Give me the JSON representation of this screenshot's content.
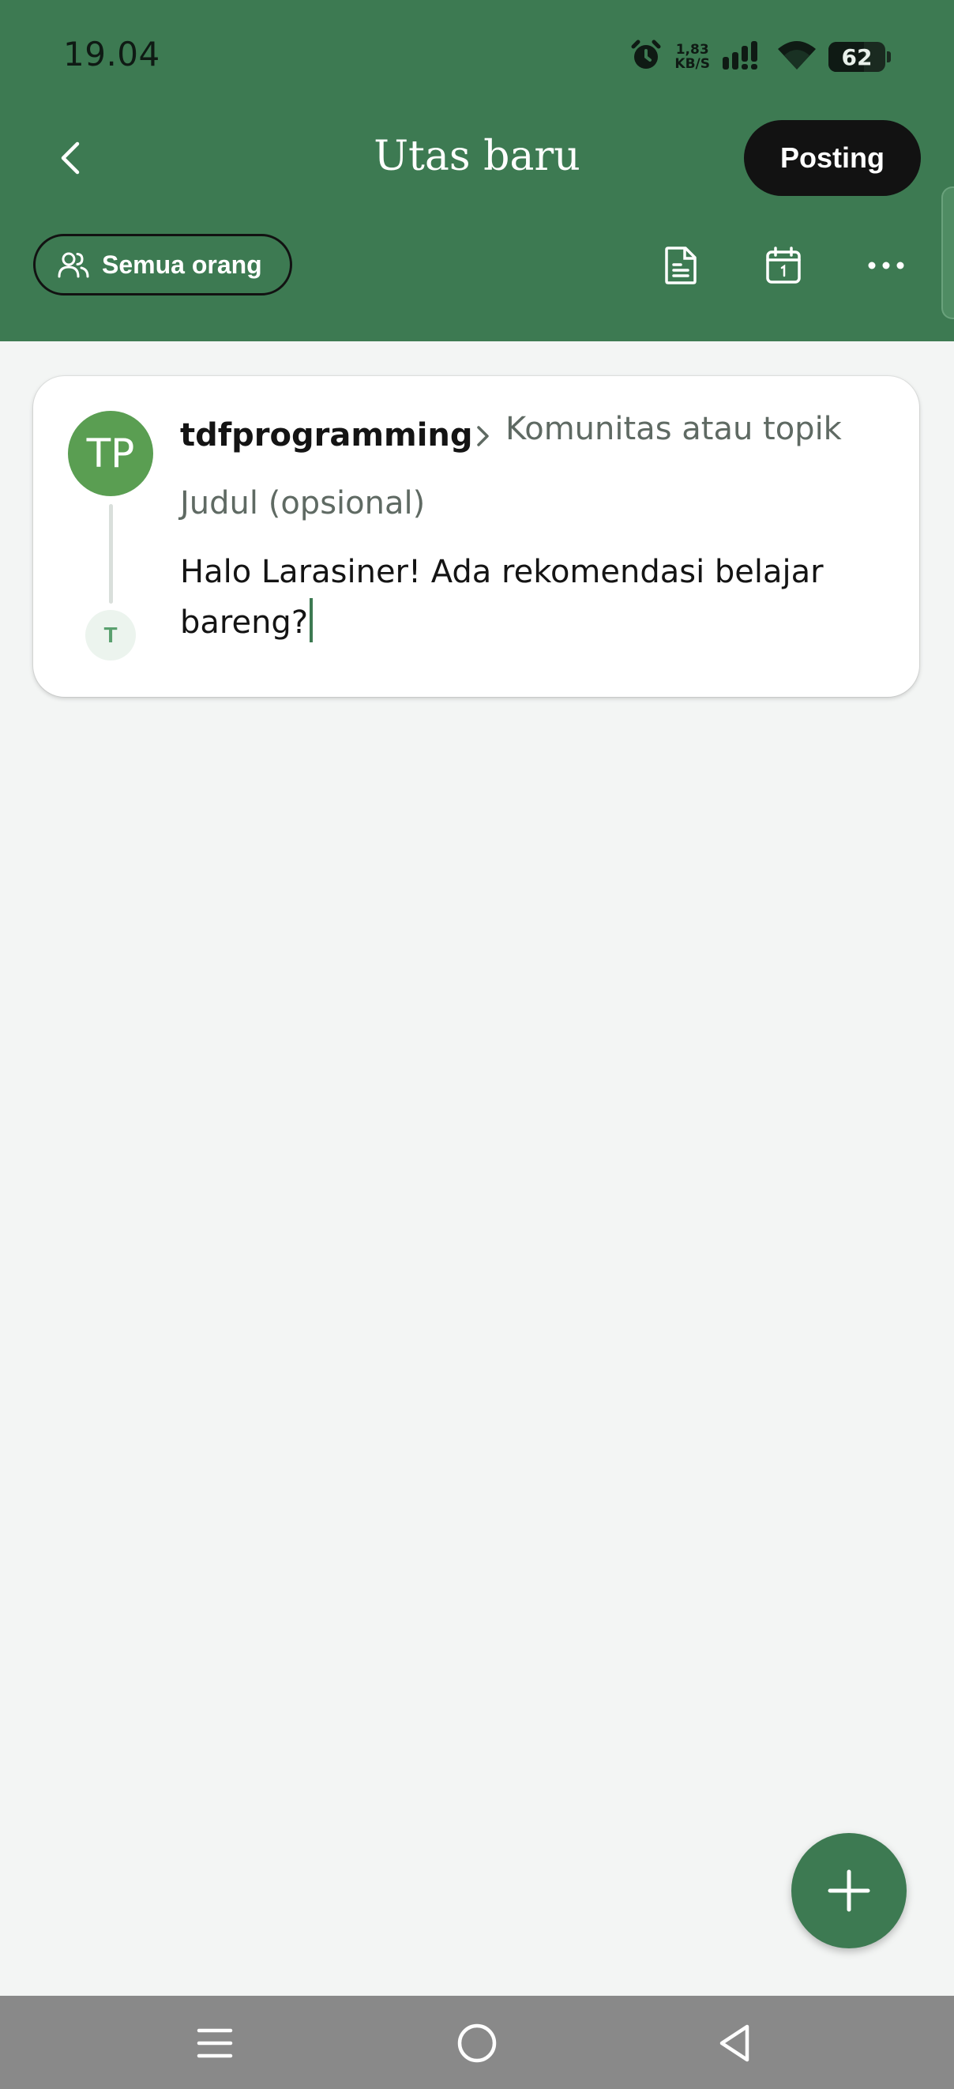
{
  "status_bar": {
    "time": "19.04",
    "net_speed_value": "1,83",
    "net_speed_unit": "KB/S",
    "battery_level": "62",
    "battery_fraction": 0.62,
    "icons": [
      "alarm-icon",
      "signal-icon",
      "wifi-icon",
      "battery-icon"
    ]
  },
  "appbar": {
    "back_icon": "chevron-left-icon",
    "title": "Utas baru",
    "post_label": "Posting"
  },
  "toolbar": {
    "audience_icon": "people-icon",
    "audience_label": "Semua orang",
    "actions": [
      "document-icon",
      "calendar-icon",
      "more-icon"
    ]
  },
  "composer": {
    "avatar_initials": "TP",
    "reply_avatar_initial": "T",
    "username": "tdfprogramming",
    "community_placeholder": "Komunitas atau topik",
    "title_placeholder": "Judul (opsional)",
    "body_text": "Halo Larasiner! Ada rekomendasi belajar bareng?"
  },
  "fab": {
    "icon": "plus-icon"
  },
  "nav_bar": {
    "buttons": [
      "menu-icon",
      "home-icon",
      "back-triangle-icon"
    ]
  },
  "colors": {
    "header_green": "#3d7a52",
    "avatar_green": "#5a9e52",
    "background": "#f3f5f4",
    "post_button": "#121212",
    "nav_bar": "#898989"
  }
}
